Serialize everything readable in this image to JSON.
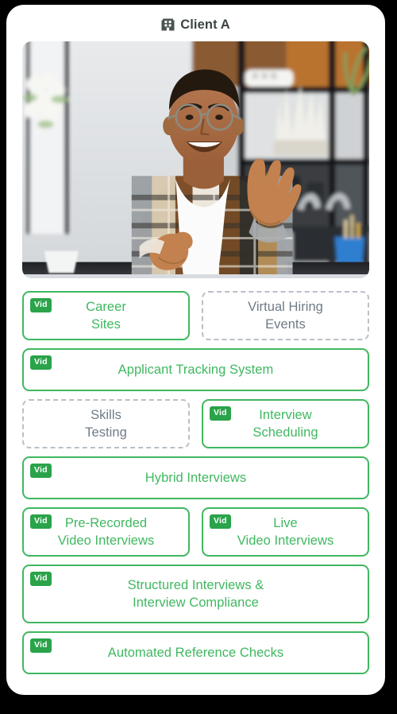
{
  "header": {
    "title": "Client A",
    "icon": "building-icon",
    "title_color": "#3b4543"
  },
  "hero": {
    "alt": "Smiling man with glasses in plaid shirt gesturing at a desk with shelves behind him",
    "icon": "photo"
  },
  "theme": {
    "active_color": "#3fb860",
    "inactive_color": "#6f7b86",
    "badge_bg": "#2aa34a",
    "badge_text_color": "#ffffff",
    "panel_bg": "#ffffff",
    "page_bg": "#000000",
    "inactive_border": "#b9c0c7"
  },
  "badge": {
    "label": "Vid"
  },
  "rows": [
    {
      "cards": [
        {
          "label": "Career\nSites",
          "state": "active",
          "badge": "Vid",
          "lines": 2
        },
        {
          "label": "Virtual Hiring\nEvents",
          "state": "inactive",
          "badge": null,
          "lines": 2
        }
      ]
    },
    {
      "cards": [
        {
          "label": "Applicant Tracking System",
          "state": "active",
          "badge": "Vid",
          "lines": 1
        }
      ]
    },
    {
      "cards": [
        {
          "label": "Skills\nTesting",
          "state": "inactive",
          "badge": null,
          "lines": 2
        },
        {
          "label": "Interview\nScheduling",
          "state": "active",
          "badge": "Vid",
          "lines": 2
        }
      ]
    },
    {
      "cards": [
        {
          "label": "Hybrid Interviews",
          "state": "active",
          "badge": "Vid",
          "lines": 1
        }
      ]
    },
    {
      "cards": [
        {
          "label": "Pre-Recorded\nVideo Interviews",
          "state": "active",
          "badge": "Vid",
          "lines": 2
        },
        {
          "label": "Live\nVideo Interviews",
          "state": "active",
          "badge": "Vid",
          "lines": 2
        }
      ]
    },
    {
      "cards": [
        {
          "label": "Structured Interviews &\nInterview Compliance",
          "state": "active",
          "badge": "Vid",
          "lines": 2
        }
      ]
    },
    {
      "cards": [
        {
          "label": "Automated Reference Checks",
          "state": "active",
          "badge": "Vid",
          "lines": 1
        }
      ]
    }
  ]
}
